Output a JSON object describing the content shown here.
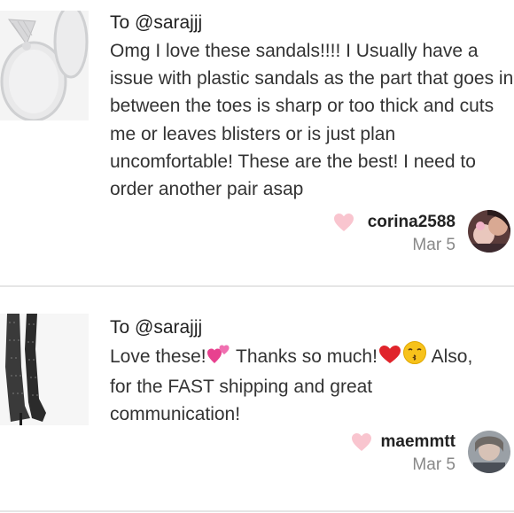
{
  "reviews": [
    {
      "to": "To @sarajjj",
      "message": "Omg I love these sandals!!!! I Usually have a issue with plastic sandals as the part that goes in between the toes is sharp or too thick and cuts me or leaves blisters or is just plan uncomfortable! These are the best! I need to order another pair asap",
      "username": "corina2588",
      "date": "Mar 5",
      "thumbnail_icon": "sandal-icon"
    },
    {
      "to": "To @sarajjj",
      "message_parts": [
        "Love these!",
        "two-hearts-emoji",
        " Thanks so much!",
        "red-heart-emoji",
        "kissing-face-emoji",
        " Also,",
        "for the FAST shipping and great",
        "communication!"
      ],
      "msg_a": "Love these!",
      "msg_b": " Thanks so much!",
      "msg_c": " Also,",
      "msg_line2": "for the FAST shipping and great",
      "msg_line3": "communication!",
      "username": "maemmtt",
      "date": "Mar 5",
      "thumbnail_icon": "boot-icon"
    }
  ],
  "colors": {
    "heart": "#f9c5cf",
    "divider": "#e6e6e6",
    "date": "#888888"
  }
}
